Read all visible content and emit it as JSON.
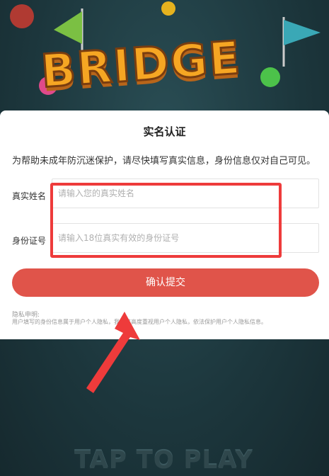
{
  "game": {
    "logo_text": "BRIDGE",
    "tap_prompt": "TAP TO PLAY"
  },
  "dialog": {
    "title": "实名认证",
    "description": "为帮助未成年防沉迷保护，请尽快填写真实信息，身份信息仅对自己可见。",
    "fields": [
      {
        "label": "真实姓名",
        "placeholder": "请输入您的真实姓名"
      },
      {
        "label": "身份证号",
        "placeholder": "请输入18位真实有效的身份证号"
      }
    ],
    "submit_label": "确认提交",
    "privacy_title": "隐私申明:",
    "privacy_text": "用户填写的身份信息属于用户个人隐私，我司将高度重视用户个人隐私，依法保护用户个人隐私信息。"
  },
  "colors": {
    "accent": "#e0544a",
    "annotation": "#ee3b3b"
  }
}
